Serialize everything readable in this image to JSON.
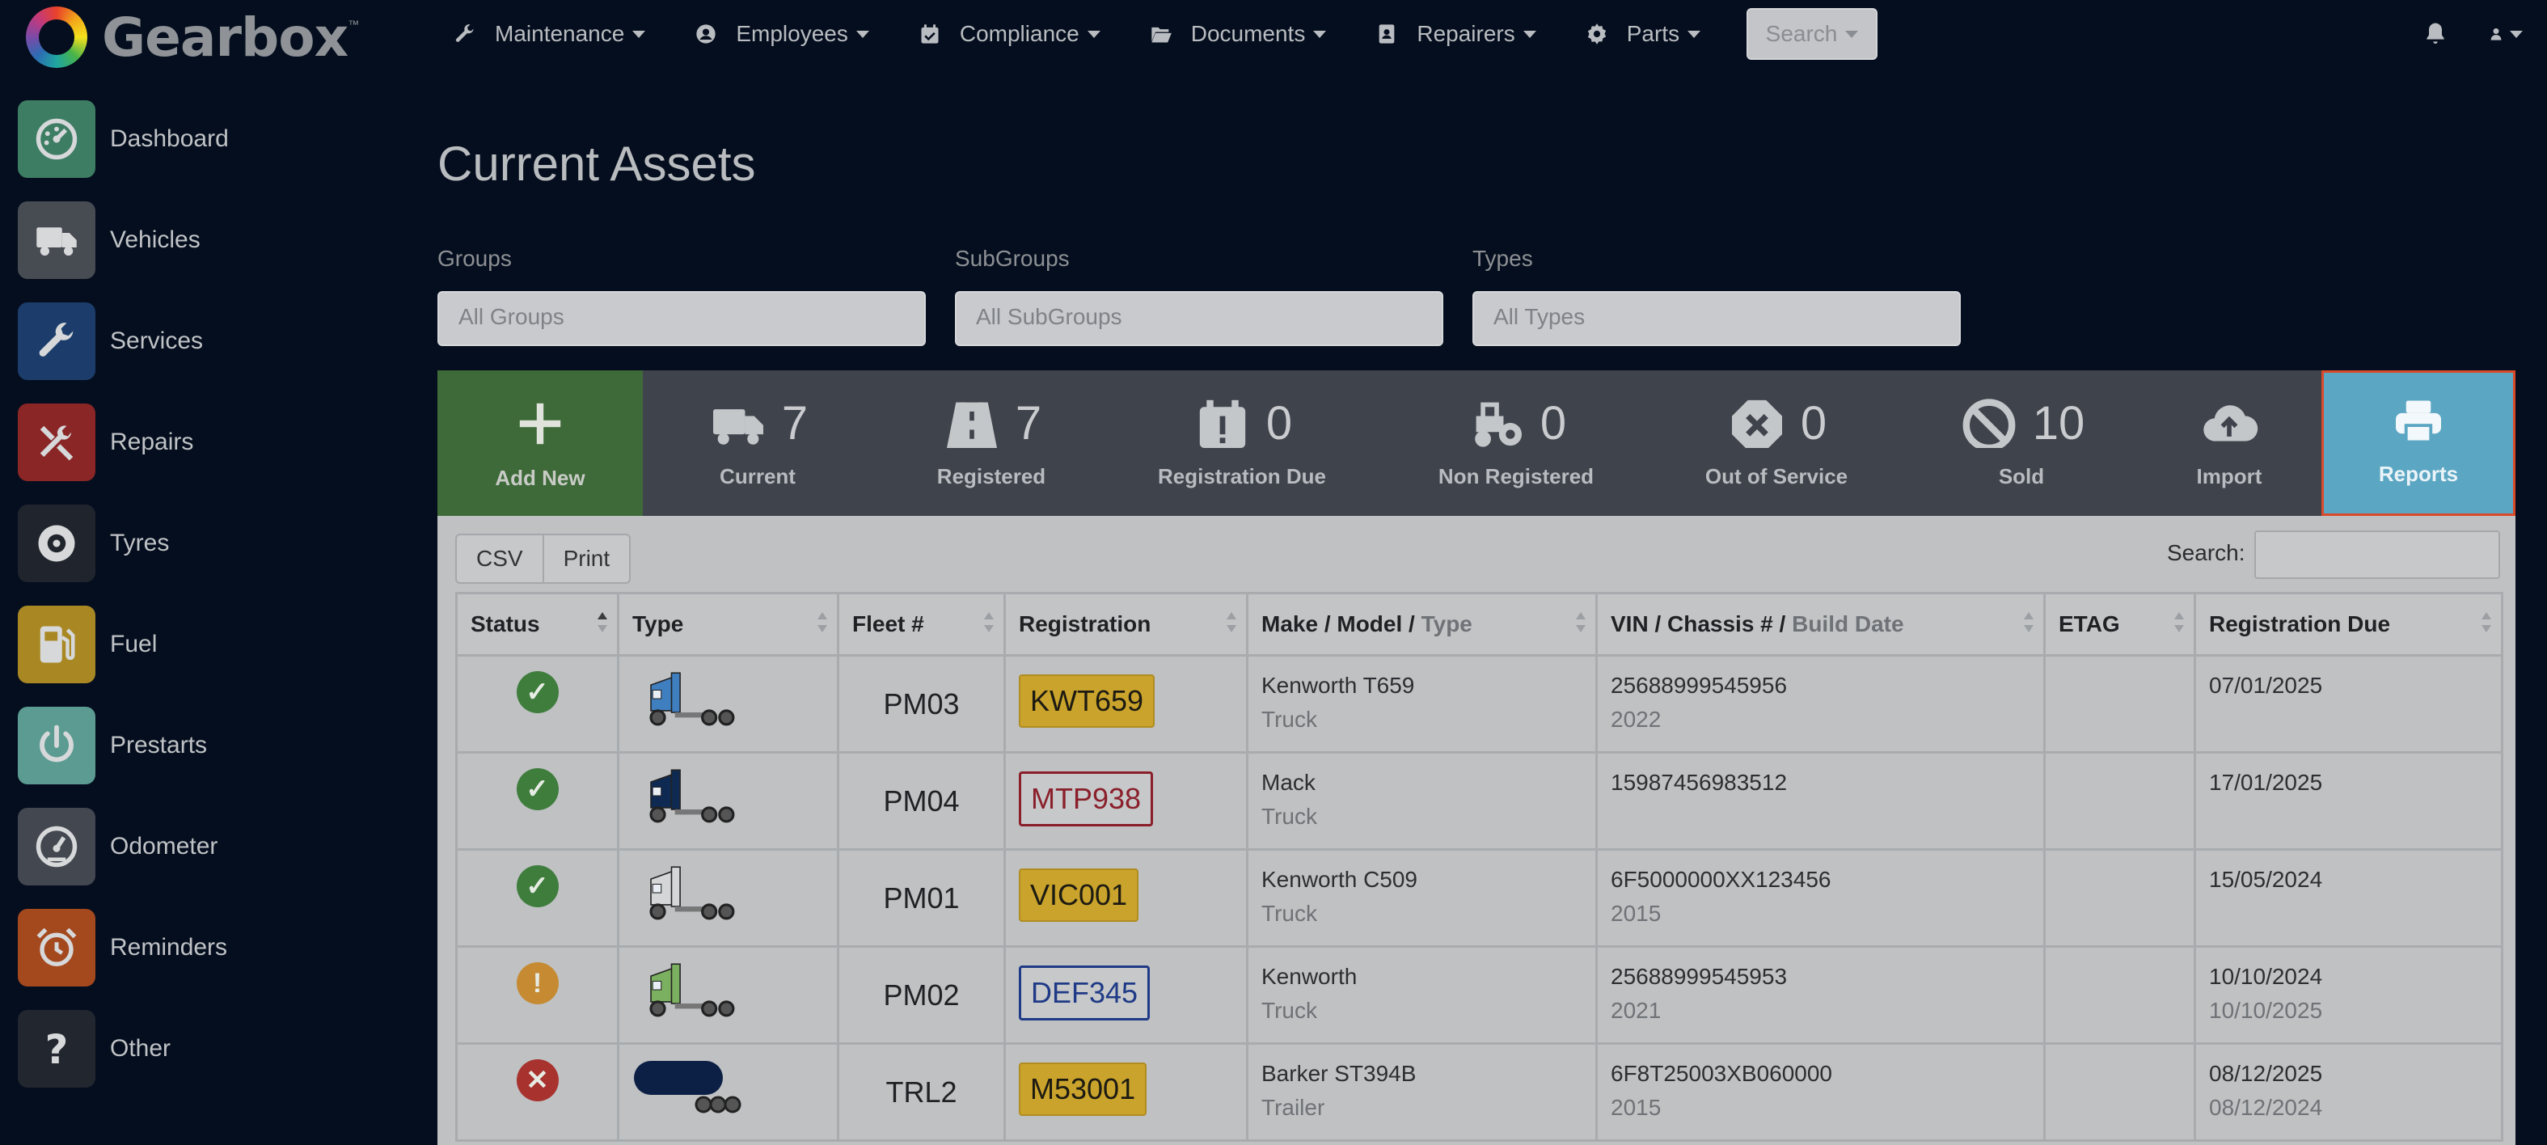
{
  "brand": {
    "name": "Gearbox",
    "tm": "™"
  },
  "topnav": [
    {
      "label": "Maintenance",
      "icon": "wrench-icon"
    },
    {
      "label": "Employees",
      "icon": "user-circle-icon"
    },
    {
      "label": "Compliance",
      "icon": "calendar-check-icon"
    },
    {
      "label": "Documents",
      "icon": "folder-open-icon"
    },
    {
      "label": "Repairers",
      "icon": "address-book-icon"
    },
    {
      "label": "Parts",
      "icon": "gear-icon"
    }
  ],
  "search_button": "Search",
  "sidebar": [
    {
      "label": "Dashboard",
      "icon": "dashboard-icon",
      "color": "#3d7d63"
    },
    {
      "label": "Vehicles",
      "icon": "truck-icon",
      "color": "#474b52"
    },
    {
      "label": "Services",
      "icon": "wrench-icon",
      "color": "#1c3d6b"
    },
    {
      "label": "Repairs",
      "icon": "tools-icon",
      "color": "#8a2626"
    },
    {
      "label": "Tyres",
      "icon": "tyre-icon",
      "color": "#20252d"
    },
    {
      "label": "Fuel",
      "icon": "fuel-pump-icon",
      "color": "#a98824"
    },
    {
      "label": "Prestarts",
      "icon": "power-icon",
      "color": "#5b9b91"
    },
    {
      "label": "Odometer",
      "icon": "odometer-icon",
      "color": "#43474f"
    },
    {
      "label": "Reminders",
      "icon": "alarm-clock-icon",
      "color": "#a4481e"
    },
    {
      "label": "Other",
      "icon": "question-icon",
      "color": "#22272f"
    }
  ],
  "page_title": "Current Assets",
  "filters": [
    {
      "label": "Groups",
      "value": "All Groups"
    },
    {
      "label": "SubGroups",
      "value": "All SubGroups"
    },
    {
      "label": "Types",
      "value": "All Types"
    }
  ],
  "stats": {
    "add_new": "Add New",
    "items": [
      {
        "label": "Current",
        "count": "7",
        "icon": "truck-icon"
      },
      {
        "label": "Registered",
        "count": "7",
        "icon": "road-icon"
      },
      {
        "label": "Registration Due",
        "count": "0",
        "icon": "calendar-alert-icon"
      },
      {
        "label": "Non Registered",
        "count": "0",
        "icon": "tractor-icon"
      },
      {
        "label": "Out of Service",
        "count": "0",
        "icon": "octagon-x-icon"
      },
      {
        "label": "Sold",
        "count": "10",
        "icon": "ban-icon"
      },
      {
        "label": "Import",
        "count": "",
        "icon": "cloud-upload-icon"
      }
    ],
    "reports": "Reports"
  },
  "table_tools": {
    "csv": "CSV",
    "print": "Print",
    "search_label": "Search:"
  },
  "table": {
    "headers": [
      {
        "main": "Status",
        "sub": ""
      },
      {
        "main": "Type",
        "sub": ""
      },
      {
        "main": "Fleet #",
        "sub": ""
      },
      {
        "main": "Registration",
        "sub": ""
      },
      {
        "main": "Make / Model / ",
        "sub": "Type"
      },
      {
        "main": "VIN / Chassis # / ",
        "sub": "Build Date"
      },
      {
        "main": "ETAG",
        "sub": ""
      },
      {
        "main": "Registration Due",
        "sub": ""
      }
    ],
    "rows": [
      {
        "status": "ok",
        "vehicle_color": "#3f7fbf",
        "vehicle": "truck",
        "fleet": "PM03",
        "reg": "KWT659",
        "reg_style": "yellow",
        "make": "Kenworth T659",
        "type": "Truck",
        "vin": "25688999545956",
        "build": "2022",
        "etag": "",
        "due1": "07/01/2025",
        "due2": ""
      },
      {
        "status": "ok",
        "vehicle_color": "#0f2a52",
        "vehicle": "truck",
        "fleet": "PM04",
        "reg": "MTP938",
        "reg_style": "red",
        "make": "Mack",
        "type": "Truck",
        "vin": "15987456983512",
        "build": "",
        "etag": "",
        "due1": "17/01/2025",
        "due2": ""
      },
      {
        "status": "ok",
        "vehicle_color": "#d4d6d8",
        "vehicle": "truck",
        "fleet": "PM01",
        "reg": "VIC001",
        "reg_style": "yellow",
        "make": "Kenworth C509",
        "type": "Truck",
        "vin": "6F5000000XX123456",
        "build": "2015",
        "etag": "",
        "due1": "15/05/2024",
        "due2": ""
      },
      {
        "status": "warn",
        "vehicle_color": "#7bb060",
        "vehicle": "truck",
        "fleet": "PM02",
        "reg": "DEF345",
        "reg_style": "blue",
        "make": "Kenworth",
        "type": "Truck",
        "vin": "25688999545953",
        "build": "2021",
        "etag": "",
        "due1": "10/10/2024",
        "due2": "10/10/2025"
      },
      {
        "status": "error",
        "vehicle_color": "#0c1f45",
        "vehicle": "trailer",
        "fleet": "TRL2",
        "reg": "M53001",
        "reg_style": "yellow",
        "make": "Barker ST394B",
        "type": "Trailer",
        "vin": "6F8T25003XB060000",
        "build": "2015",
        "etag": "",
        "due1": "08/12/2025",
        "due2": "08/12/2024"
      }
    ]
  },
  "colors": {
    "ok": "#3f7d3d",
    "warn": "#c68a32",
    "error": "#a8322e",
    "add_new": "#3d6a38",
    "reports": "#5ba6c3"
  }
}
